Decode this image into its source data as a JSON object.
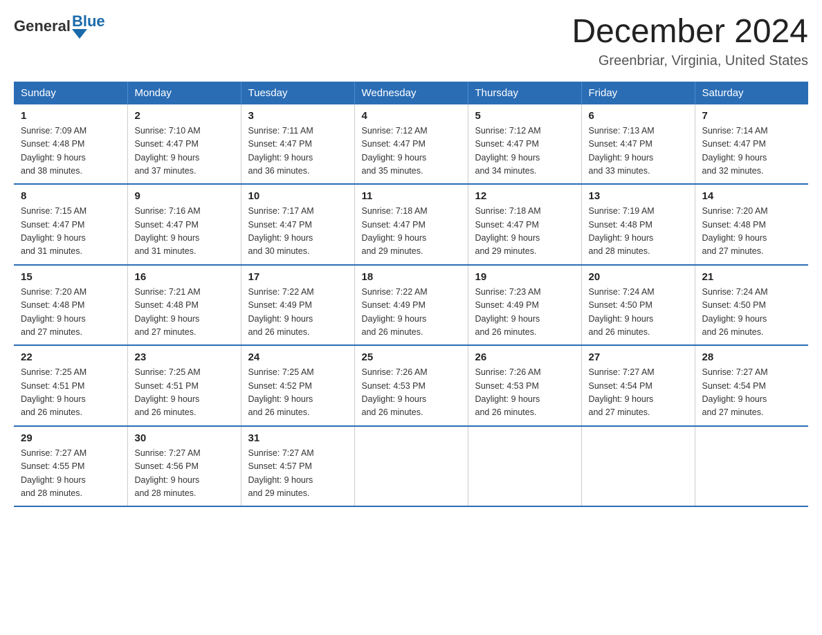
{
  "logo": {
    "general": "General",
    "blue": "Blue"
  },
  "title": "December 2024",
  "location": "Greenbriar, Virginia, United States",
  "days_of_week": [
    "Sunday",
    "Monday",
    "Tuesday",
    "Wednesday",
    "Thursday",
    "Friday",
    "Saturday"
  ],
  "weeks": [
    [
      {
        "day": "1",
        "sunrise": "7:09 AM",
        "sunset": "4:48 PM",
        "daylight": "9 hours and 38 minutes."
      },
      {
        "day": "2",
        "sunrise": "7:10 AM",
        "sunset": "4:47 PM",
        "daylight": "9 hours and 37 minutes."
      },
      {
        "day": "3",
        "sunrise": "7:11 AM",
        "sunset": "4:47 PM",
        "daylight": "9 hours and 36 minutes."
      },
      {
        "day": "4",
        "sunrise": "7:12 AM",
        "sunset": "4:47 PM",
        "daylight": "9 hours and 35 minutes."
      },
      {
        "day": "5",
        "sunrise": "7:12 AM",
        "sunset": "4:47 PM",
        "daylight": "9 hours and 34 minutes."
      },
      {
        "day": "6",
        "sunrise": "7:13 AM",
        "sunset": "4:47 PM",
        "daylight": "9 hours and 33 minutes."
      },
      {
        "day": "7",
        "sunrise": "7:14 AM",
        "sunset": "4:47 PM",
        "daylight": "9 hours and 32 minutes."
      }
    ],
    [
      {
        "day": "8",
        "sunrise": "7:15 AM",
        "sunset": "4:47 PM",
        "daylight": "9 hours and 31 minutes."
      },
      {
        "day": "9",
        "sunrise": "7:16 AM",
        "sunset": "4:47 PM",
        "daylight": "9 hours and 31 minutes."
      },
      {
        "day": "10",
        "sunrise": "7:17 AM",
        "sunset": "4:47 PM",
        "daylight": "9 hours and 30 minutes."
      },
      {
        "day": "11",
        "sunrise": "7:18 AM",
        "sunset": "4:47 PM",
        "daylight": "9 hours and 29 minutes."
      },
      {
        "day": "12",
        "sunrise": "7:18 AM",
        "sunset": "4:47 PM",
        "daylight": "9 hours and 29 minutes."
      },
      {
        "day": "13",
        "sunrise": "7:19 AM",
        "sunset": "4:48 PM",
        "daylight": "9 hours and 28 minutes."
      },
      {
        "day": "14",
        "sunrise": "7:20 AM",
        "sunset": "4:48 PM",
        "daylight": "9 hours and 27 minutes."
      }
    ],
    [
      {
        "day": "15",
        "sunrise": "7:20 AM",
        "sunset": "4:48 PM",
        "daylight": "9 hours and 27 minutes."
      },
      {
        "day": "16",
        "sunrise": "7:21 AM",
        "sunset": "4:48 PM",
        "daylight": "9 hours and 27 minutes."
      },
      {
        "day": "17",
        "sunrise": "7:22 AM",
        "sunset": "4:49 PM",
        "daylight": "9 hours and 26 minutes."
      },
      {
        "day": "18",
        "sunrise": "7:22 AM",
        "sunset": "4:49 PM",
        "daylight": "9 hours and 26 minutes."
      },
      {
        "day": "19",
        "sunrise": "7:23 AM",
        "sunset": "4:49 PM",
        "daylight": "9 hours and 26 minutes."
      },
      {
        "day": "20",
        "sunrise": "7:24 AM",
        "sunset": "4:50 PM",
        "daylight": "9 hours and 26 minutes."
      },
      {
        "day": "21",
        "sunrise": "7:24 AM",
        "sunset": "4:50 PM",
        "daylight": "9 hours and 26 minutes."
      }
    ],
    [
      {
        "day": "22",
        "sunrise": "7:25 AM",
        "sunset": "4:51 PM",
        "daylight": "9 hours and 26 minutes."
      },
      {
        "day": "23",
        "sunrise": "7:25 AM",
        "sunset": "4:51 PM",
        "daylight": "9 hours and 26 minutes."
      },
      {
        "day": "24",
        "sunrise": "7:25 AM",
        "sunset": "4:52 PM",
        "daylight": "9 hours and 26 minutes."
      },
      {
        "day": "25",
        "sunrise": "7:26 AM",
        "sunset": "4:53 PM",
        "daylight": "9 hours and 26 minutes."
      },
      {
        "day": "26",
        "sunrise": "7:26 AM",
        "sunset": "4:53 PM",
        "daylight": "9 hours and 26 minutes."
      },
      {
        "day": "27",
        "sunrise": "7:27 AM",
        "sunset": "4:54 PM",
        "daylight": "9 hours and 27 minutes."
      },
      {
        "day": "28",
        "sunrise": "7:27 AM",
        "sunset": "4:54 PM",
        "daylight": "9 hours and 27 minutes."
      }
    ],
    [
      {
        "day": "29",
        "sunrise": "7:27 AM",
        "sunset": "4:55 PM",
        "daylight": "9 hours and 28 minutes."
      },
      {
        "day": "30",
        "sunrise": "7:27 AM",
        "sunset": "4:56 PM",
        "daylight": "9 hours and 28 minutes."
      },
      {
        "day": "31",
        "sunrise": "7:27 AM",
        "sunset": "4:57 PM",
        "daylight": "9 hours and 29 minutes."
      },
      null,
      null,
      null,
      null
    ]
  ],
  "labels": {
    "sunrise": "Sunrise:",
    "sunset": "Sunset:",
    "daylight": "Daylight:"
  }
}
